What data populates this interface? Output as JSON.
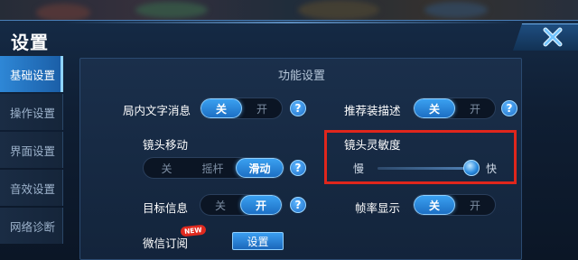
{
  "window": {
    "title": "设置"
  },
  "sidebar": {
    "items": [
      {
        "label": "基础设置",
        "active": true
      },
      {
        "label": "操作设置",
        "active": false
      },
      {
        "label": "界面设置",
        "active": false
      },
      {
        "label": "音效设置",
        "active": false
      },
      {
        "label": "网络诊断",
        "active": false
      }
    ]
  },
  "panel": {
    "title": "功能设置",
    "in_game_text": {
      "label": "局内文字消息",
      "off": "关",
      "on": "开",
      "value": "关"
    },
    "recommend_desc": {
      "label": "推荐装描述",
      "off": "关",
      "on": "开",
      "value": "关"
    },
    "camera_move": {
      "label": "镜头移动",
      "options": [
        "关",
        "摇杆",
        "滑动"
      ],
      "value": "滑动"
    },
    "camera_sens": {
      "label": "镜头灵敏度",
      "min_label": "慢",
      "max_label": "快",
      "value": 0.95
    },
    "target_info": {
      "label": "目标信息",
      "off": "关",
      "on": "开",
      "value": "开"
    },
    "fps_display": {
      "label": "帧率显示",
      "off": "关",
      "on": "开",
      "value": "关"
    },
    "wechat_sub": {
      "label": "微信订阅",
      "badge": "NEW",
      "button": "设置"
    },
    "help_glyph": "?"
  },
  "colors": {
    "accent": "#2e87d6",
    "highlight": "#e0261c"
  }
}
